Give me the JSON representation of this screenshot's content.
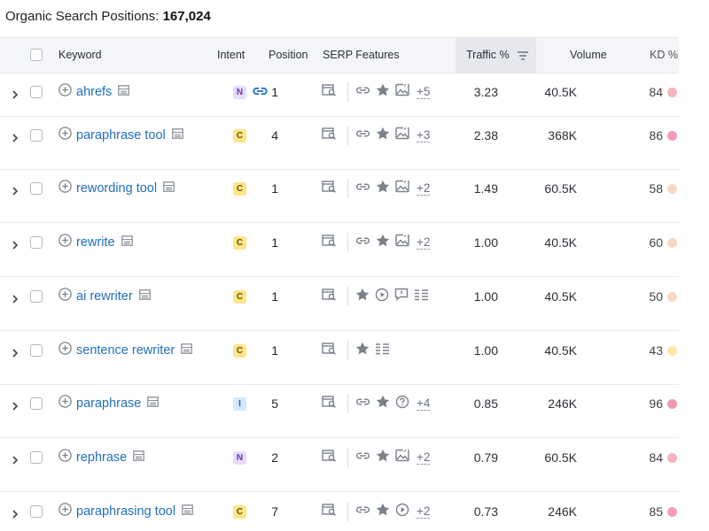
{
  "header": {
    "title_label": "Organic Search Positions:",
    "title_count": "167,024"
  },
  "columns": {
    "keyword": "Keyword",
    "intent": "Intent",
    "position": "Position",
    "serp": "SERP Features",
    "traffic": "Traffic %",
    "volume": "Volume",
    "kd": "KD %"
  },
  "colors": {
    "link": "#1f6fbf",
    "kd_red": "#f3a4b7",
    "kd_pink": "#f6bcc6",
    "kd_orange": "#fcd4bd",
    "kd_yellow": "#fde9a8"
  },
  "rows": [
    {
      "keyword": "ahrefs",
      "intent": "N",
      "position_link": true,
      "position": "1",
      "serp_icons": [
        "link-icon",
        "star-icon",
        "image-icon"
      ],
      "serp_more": "+5",
      "traffic": "3.23",
      "volume": "40.5K",
      "kd": "84",
      "kd_color": "#f6b3bf"
    },
    {
      "keyword": "paraphrase tool",
      "intent": "C",
      "position_link": false,
      "position": "4",
      "serp_icons": [
        "link-icon",
        "star-icon",
        "image-icon"
      ],
      "serp_more": "+3",
      "traffic": "2.38",
      "volume": "368K",
      "kd": "86",
      "kd_color": "#f19fb2"
    },
    {
      "keyword": "rewording tool",
      "intent": "C",
      "position_link": false,
      "position": "1",
      "serp_icons": [
        "link-icon",
        "star-icon",
        "image-icon"
      ],
      "serp_more": "+2",
      "traffic": "1.49",
      "volume": "60.5K",
      "kd": "58",
      "kd_color": "#fcd5c0"
    },
    {
      "keyword": "rewrite",
      "intent": "C",
      "position_link": false,
      "position": "1",
      "serp_icons": [
        "link-icon",
        "star-icon",
        "image-icon"
      ],
      "serp_more": "+2",
      "traffic": "1.00",
      "volume": "40.5K",
      "kd": "60",
      "kd_color": "#fcd5c0"
    },
    {
      "keyword": "ai rewriter",
      "intent": "C",
      "position_link": false,
      "position": "1",
      "serp_icons": [
        "star-icon",
        "video-icon",
        "review-icon",
        "list-icon"
      ],
      "serp_more": "",
      "traffic": "1.00",
      "volume": "40.5K",
      "kd": "50",
      "kd_color": "#fcd8c2"
    },
    {
      "keyword": "sentence rewriter",
      "intent": "C",
      "position_link": false,
      "position": "1",
      "serp_icons": [
        "star-icon",
        "list-icon"
      ],
      "serp_more": "",
      "traffic": "1.00",
      "volume": "40.5K",
      "kd": "43",
      "kd_color": "#fde8a9"
    },
    {
      "keyword": "paraphrase",
      "intent": "I",
      "position_link": false,
      "position": "5",
      "serp_icons": [
        "link-icon",
        "star-icon",
        "question-icon"
      ],
      "serp_more": "+4",
      "traffic": "0.85",
      "volume": "246K",
      "kd": "96",
      "kd_color": "#ef9ab0"
    },
    {
      "keyword": "rephrase",
      "intent": "N",
      "position_link": false,
      "position": "2",
      "serp_icons": [
        "link-icon",
        "star-icon",
        "image-icon"
      ],
      "serp_more": "+2",
      "traffic": "0.79",
      "volume": "60.5K",
      "kd": "84",
      "kd_color": "#f6b3bf"
    },
    {
      "keyword": "paraphrasing tool",
      "intent": "C",
      "position_link": false,
      "position": "7",
      "serp_icons": [
        "link-icon",
        "star-icon",
        "video-icon"
      ],
      "serp_more": "+2",
      "traffic": "0.73",
      "volume": "246K",
      "kd": "85",
      "kd_color": "#f19fb2"
    }
  ]
}
